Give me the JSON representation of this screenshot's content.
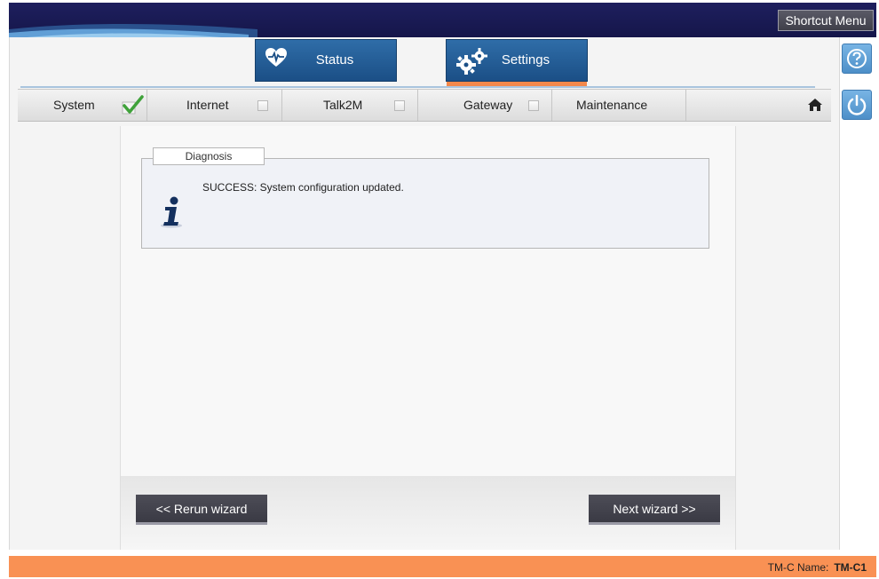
{
  "header": {
    "shortcut_label": "Shortcut Menu"
  },
  "tabs": [
    {
      "label": "Status",
      "icon": "heart-monitor-icon",
      "active": false
    },
    {
      "label": "Settings",
      "icon": "gears-icon",
      "active": true
    }
  ],
  "steps": [
    {
      "label": "System",
      "checked": true
    },
    {
      "label": "Internet",
      "checked": false
    },
    {
      "label": "Talk2M",
      "checked": false
    },
    {
      "label": "Gateway",
      "checked": false
    },
    {
      "label": "Maintenance"
    }
  ],
  "diagnosis": {
    "legend": "Diagnosis",
    "message": "SUCCESS: System configuration updated.",
    "icon": "info-icon"
  },
  "wizard": {
    "rerun_label": "<< Rerun wizard",
    "next_label": "Next wizard >>"
  },
  "footer": {
    "name_label": "TM-C Name:",
    "name_value": "TM-C1"
  },
  "colors": {
    "top_bar": "#1e1f5e",
    "tab_blue": "#1b4f86",
    "accent_orange": "#f99154",
    "button_dark": "#3a3a44",
    "side_icon_blue": "#4d8fc8"
  }
}
